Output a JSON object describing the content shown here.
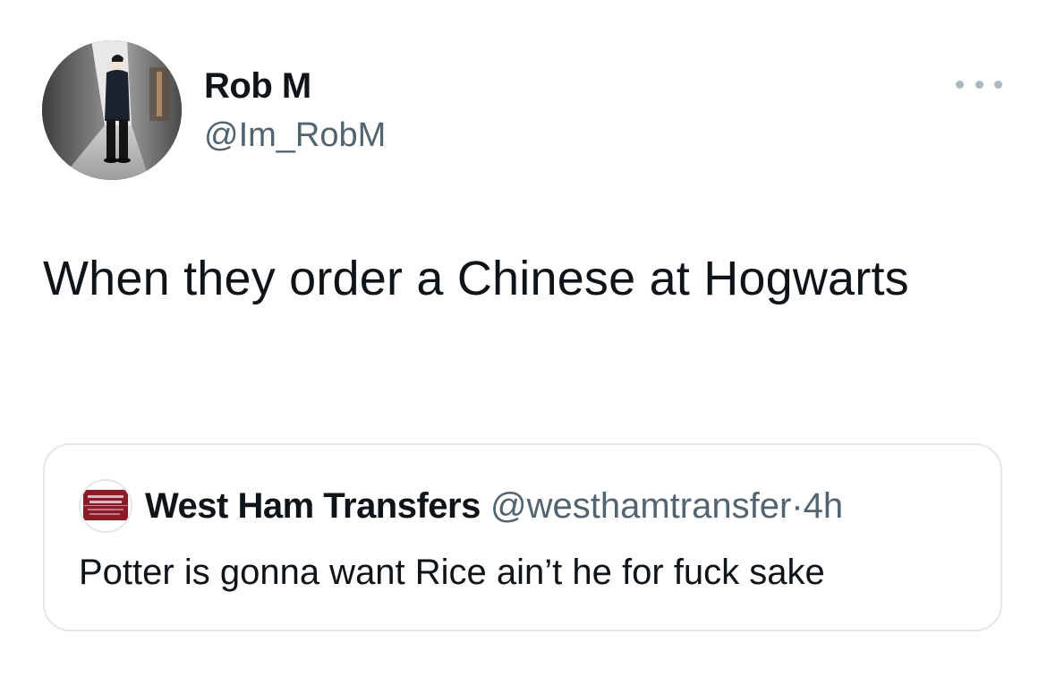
{
  "tweet": {
    "author": {
      "name": "Rob M",
      "handle": "@Im_RobM"
    },
    "text": "When they order a Chinese at Hogwarts",
    "more_icon": "more-horizontal-icon"
  },
  "quote": {
    "author": {
      "name": "West Ham Transfers",
      "handle": "@westhamtransfer",
      "avatar_logo_text": "WEST HAM TRANSFERS"
    },
    "separator": "·",
    "time": "4h",
    "text": "Potter is gonna want Rice ain’t he for fuck sake"
  },
  "colors": {
    "text_primary": "#0f1419",
    "text_secondary": "#536471",
    "border": "#e1e8ed",
    "more_dots": "#aab8c2",
    "quote_logo_red": "#8b1a2b"
  }
}
